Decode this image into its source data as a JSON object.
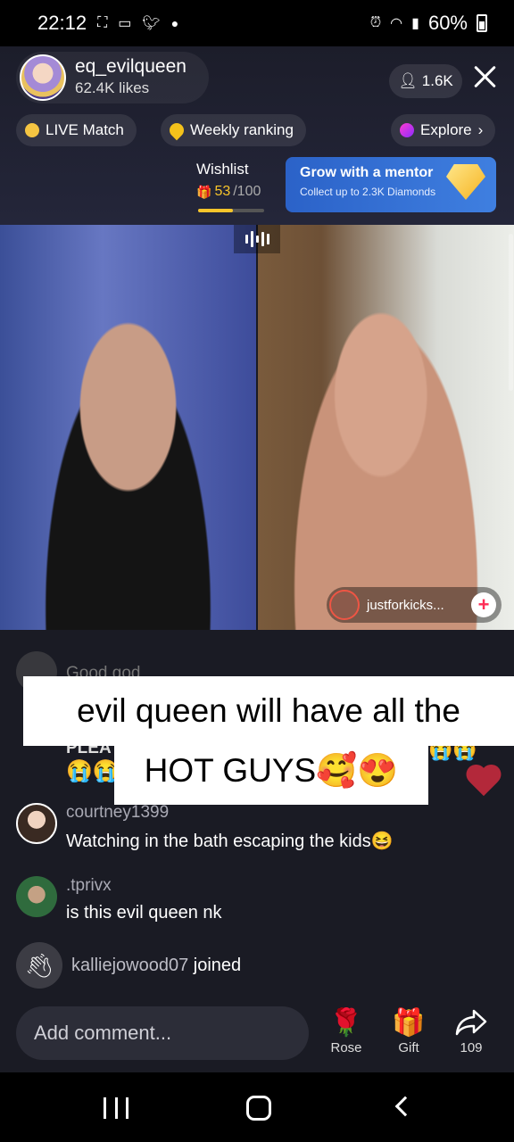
{
  "status_bar": {
    "time": "22:12",
    "battery": "60%",
    "icons": [
      "screenshot-icon",
      "cast-icon",
      "twitter-icon",
      "dot-icon",
      "alarm-icon",
      "wifi-icon",
      "signal-icon",
      "battery-icon"
    ]
  },
  "host": {
    "name": "eq_evilqueen",
    "likes": "62.4K likes"
  },
  "viewers": {
    "count": "1.6K"
  },
  "chips": {
    "live_match": "LIVE Match",
    "weekly_ranking": "Weekly ranking",
    "explore": "Explore"
  },
  "wishlist": {
    "label": "Wishlist",
    "current": "53",
    "total": "/100",
    "progress": 0.53
  },
  "mentor": {
    "title": "Grow with a mentor",
    "subtitle": "Collect up to 2.3K Diamonds"
  },
  "guest": {
    "name": "justforkicks..."
  },
  "overlay": {
    "line1": "evil queen will have all the",
    "line2": "HOT GUYS🥰😍"
  },
  "comments": {
    "faint_partial": "Good god",
    "faint_partial2": "PLEA",
    "emoji_row": "😭😭",
    "emoji_row_right": "😭😭",
    "items": [
      {
        "user": "courtney1399",
        "text": "Watching in the bath escaping the kids😆"
      },
      {
        "user": ".tprivx",
        "text": "is this evil queen nk"
      }
    ],
    "joined_user": "kalliejowood07",
    "joined_label": "joined"
  },
  "bottom": {
    "placeholder": "Add comment...",
    "rose": "Rose",
    "gift": "Gift",
    "share_count": "109"
  },
  "colors": {
    "accent": "#fe2c55",
    "mentor_bg": "#2b62c8",
    "wishlist_fill": "#f7c52b"
  }
}
